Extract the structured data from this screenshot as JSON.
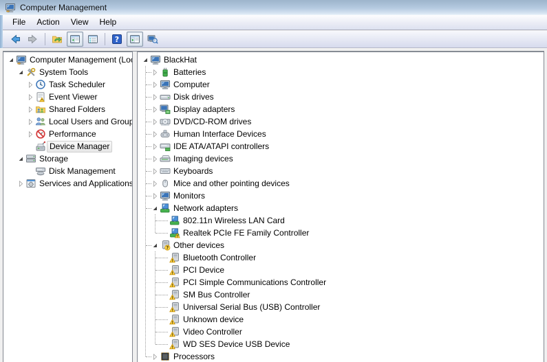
{
  "window": {
    "title": "Computer Management",
    "icon": "computer-mgmt"
  },
  "menu": {
    "items": [
      {
        "label": "File"
      },
      {
        "label": "Action"
      },
      {
        "label": "View"
      },
      {
        "label": "Help"
      }
    ]
  },
  "toolbar": {
    "buttons": [
      {
        "name": "back",
        "icon": "arrow-back",
        "pressed": false
      },
      {
        "name": "forward",
        "icon": "arrow-forward",
        "pressed": false
      },
      {
        "type": "separator"
      },
      {
        "name": "export-list",
        "icon": "folder-export",
        "pressed": false
      },
      {
        "name": "show-hide-console-tree",
        "icon": "window-console-tree",
        "pressed": true
      },
      {
        "name": "properties",
        "icon": "window-properties",
        "pressed": false
      },
      {
        "type": "separator"
      },
      {
        "name": "help",
        "icon": "help",
        "pressed": false
      },
      {
        "name": "show-hide-action-pane",
        "icon": "window-action-pane",
        "pressed": true
      },
      {
        "name": "scan-for-hardware-changes",
        "icon": "computer-magnifier",
        "pressed": false
      }
    ]
  },
  "console_tree": {
    "items": [
      {
        "label": "Computer Management (Local",
        "level": 0,
        "expand": "expanded",
        "icon": "computer-mgmt"
      },
      {
        "label": "System Tools",
        "level": 1,
        "expand": "expanded",
        "icon": "system-tools"
      },
      {
        "label": "Task Scheduler",
        "level": 2,
        "expand": "collapsed",
        "icon": "task-scheduler"
      },
      {
        "label": "Event Viewer",
        "level": 2,
        "expand": "collapsed",
        "icon": "event-viewer"
      },
      {
        "label": "Shared Folders",
        "level": 2,
        "expand": "collapsed",
        "icon": "shared-folders"
      },
      {
        "label": "Local Users and Groups",
        "level": 2,
        "expand": "collapsed",
        "icon": "local-users"
      },
      {
        "label": "Performance",
        "level": 2,
        "expand": "collapsed",
        "icon": "performance"
      },
      {
        "label": "Device Manager",
        "level": 2,
        "expand": "none",
        "icon": "device-manager",
        "selected": true
      },
      {
        "label": "Storage",
        "level": 1,
        "expand": "expanded",
        "icon": "storage"
      },
      {
        "label": "Disk Management",
        "level": 2,
        "expand": "none",
        "icon": "disk-management"
      },
      {
        "label": "Services and Applications",
        "level": 1,
        "expand": "collapsed",
        "icon": "services-apps"
      }
    ]
  },
  "device_tree": {
    "items": [
      {
        "label": "BlackHat",
        "level": 0,
        "expand": "expanded",
        "icon": "computer"
      },
      {
        "label": "Batteries",
        "level": 1,
        "expand": "collapsed",
        "icon": "battery"
      },
      {
        "label": "Computer",
        "level": 1,
        "expand": "collapsed",
        "icon": "computer"
      },
      {
        "label": "Disk drives",
        "level": 1,
        "expand": "collapsed",
        "icon": "disk-drive"
      },
      {
        "label": "Display adapters",
        "level": 1,
        "expand": "collapsed",
        "icon": "display-adapter"
      },
      {
        "label": "DVD/CD-ROM drives",
        "level": 1,
        "expand": "collapsed",
        "icon": "dvd-drive"
      },
      {
        "label": "Human Interface Devices",
        "level": 1,
        "expand": "collapsed",
        "icon": "hid"
      },
      {
        "label": "IDE ATA/ATAPI controllers",
        "level": 1,
        "expand": "collapsed",
        "icon": "ide-controller"
      },
      {
        "label": "Imaging devices",
        "level": 1,
        "expand": "collapsed",
        "icon": "imaging-device"
      },
      {
        "label": "Keyboards",
        "level": 1,
        "expand": "collapsed",
        "icon": "keyboard"
      },
      {
        "label": "Mice and other pointing devices",
        "level": 1,
        "expand": "collapsed",
        "icon": "mouse"
      },
      {
        "label": "Monitors",
        "level": 1,
        "expand": "collapsed",
        "icon": "monitor"
      },
      {
        "label": "Network adapters",
        "level": 1,
        "expand": "expanded",
        "icon": "network-adapter"
      },
      {
        "label": "802.11n Wireless LAN Card",
        "level": 2,
        "expand": "none",
        "icon": "network-adapter"
      },
      {
        "label": "Realtek PCIe FE Family Controller",
        "level": 2,
        "expand": "none",
        "icon": "network-adapter-warning"
      },
      {
        "label": "Other devices",
        "level": 1,
        "expand": "expanded",
        "icon": "unknown-device-question"
      },
      {
        "label": "Bluetooth Controller",
        "level": 2,
        "expand": "none",
        "icon": "unknown-device-warning"
      },
      {
        "label": "PCI Device",
        "level": 2,
        "expand": "none",
        "icon": "unknown-device-warning"
      },
      {
        "label": "PCI Simple Communications Controller",
        "level": 2,
        "expand": "none",
        "icon": "unknown-device-warning"
      },
      {
        "label": "SM Bus Controller",
        "level": 2,
        "expand": "none",
        "icon": "unknown-device-warning"
      },
      {
        "label": "Universal Serial Bus (USB) Controller",
        "level": 2,
        "expand": "none",
        "icon": "unknown-device-warning"
      },
      {
        "label": "Unknown device",
        "level": 2,
        "expand": "none",
        "icon": "unknown-device-warning"
      },
      {
        "label": "Video Controller",
        "level": 2,
        "expand": "none",
        "icon": "unknown-device-warning"
      },
      {
        "label": "WD SES Device USB Device",
        "level": 2,
        "expand": "none",
        "icon": "unknown-device-warning"
      },
      {
        "label": "Processors",
        "level": 1,
        "expand": "collapsed",
        "icon": "processor"
      }
    ]
  },
  "colors": {
    "titlebar_top": "#9db4cb",
    "titlebar_bottom": "#eef5fb",
    "menubar_bottom": "#dde1f0",
    "toolbar_bottom": "#d7dbee",
    "window_frame_blue": "#bdd4ea",
    "pane_border": "#828790",
    "content_background": "#f0f0f0",
    "tree_selection_border": "#cfcfcf",
    "warning_badge_yellow": "#ffd54a",
    "warning_badge_outline": "#c79100",
    "text": "#000000"
  }
}
